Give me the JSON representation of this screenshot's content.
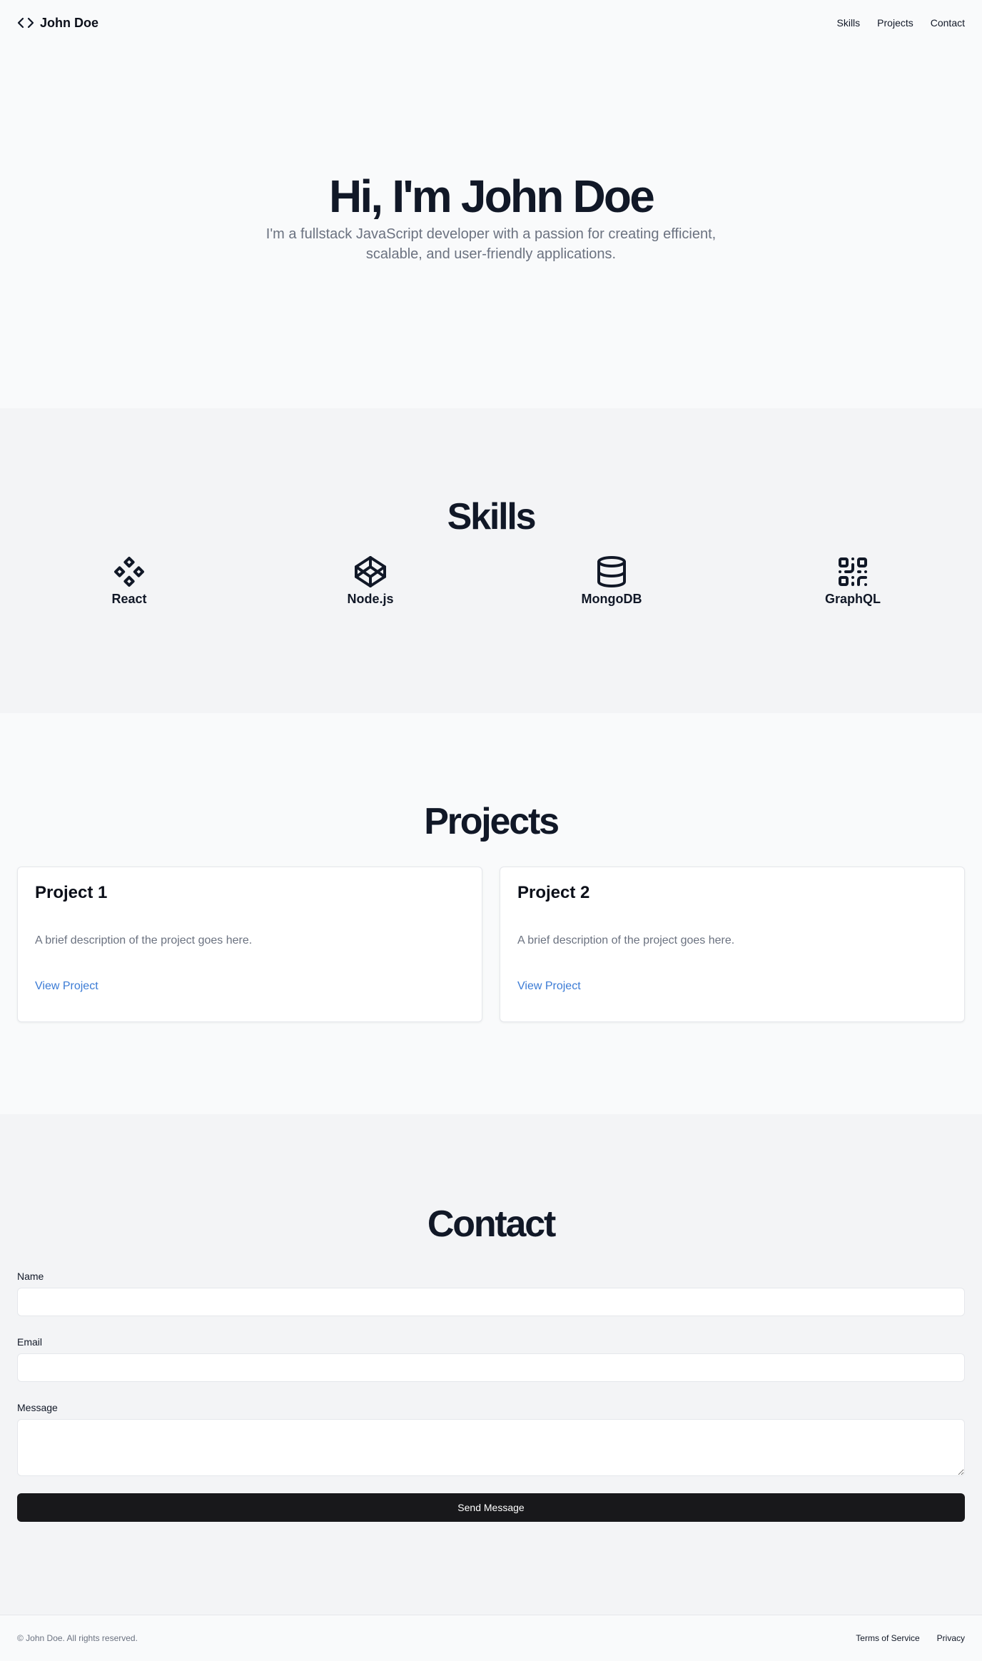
{
  "header": {
    "brand": "John Doe",
    "brand_icon": "code-icon",
    "nav": [
      {
        "label": "Skills"
      },
      {
        "label": "Projects"
      },
      {
        "label": "Contact"
      }
    ]
  },
  "hero": {
    "title": "Hi, I'm John Doe",
    "subtitle": "I'm a fullstack JavaScript developer with a passion for creating efficient, scalable, and user-friendly applications."
  },
  "skills": {
    "title": "Skills",
    "items": [
      {
        "name": "React",
        "icon": "component-icon"
      },
      {
        "name": "Node.js",
        "icon": "codepen-icon"
      },
      {
        "name": "MongoDB",
        "icon": "database-icon"
      },
      {
        "name": "GraphQL",
        "icon": "qr-code-icon"
      }
    ]
  },
  "projects": {
    "title": "Projects",
    "items": [
      {
        "title": "Project 1",
        "description": "A brief description of the project goes here.",
        "link": "View Project"
      },
      {
        "title": "Project 2",
        "description": "A brief description of the project goes here.",
        "link": "View Project"
      }
    ]
  },
  "contact": {
    "title": "Contact",
    "name_label": "Name",
    "name_value": "",
    "email_label": "Email",
    "email_value": "",
    "message_label": "Message",
    "message_value": "",
    "submit": "Send Message"
  },
  "footer": {
    "copyright": "© John Doe. All rights reserved.",
    "links": [
      {
        "label": "Terms of Service"
      },
      {
        "label": "Privacy"
      }
    ]
  },
  "colors": {
    "background": "#f9fafb",
    "section_alt": "#f3f4f6",
    "heading": "#111827",
    "muted": "#6b7280",
    "link": "#3b7bd5",
    "button": "#18181b"
  }
}
